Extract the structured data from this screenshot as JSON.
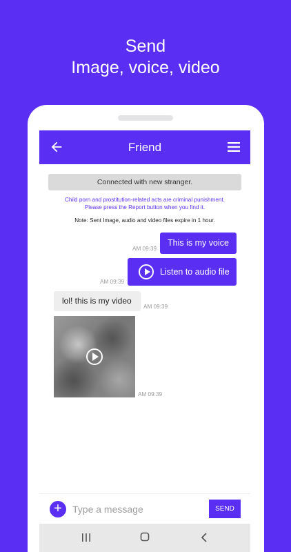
{
  "headline": {
    "line1": "Send",
    "line2": "Image, voice, video"
  },
  "appbar": {
    "title": "Friend",
    "back_icon": "arrow-back-icon",
    "menu_icon": "hamburger-menu-icon"
  },
  "chat": {
    "system_banner": "Connected with new stranger.",
    "warning_line1": "Child porn and prostitution-related acts are criminal punishment.",
    "warning_line2": "Please press the Report button when you find it.",
    "note": "Note: Sent Image, audio and video files expire in 1 hour.",
    "messages": [
      {
        "direction": "out",
        "text": "This is my voice",
        "time": "AM 09:39"
      },
      {
        "direction": "out",
        "text": "Listen to audio file",
        "time": "AM 09:39",
        "icon": "play-circle-icon"
      },
      {
        "direction": "in",
        "text": "lol! this is my video",
        "time": "AM 09:39"
      },
      {
        "direction": "in",
        "media": "video",
        "time": "AM 09:39",
        "icon": "play-circle-icon"
      }
    ]
  },
  "input": {
    "placeholder": "Type a message",
    "value": "",
    "send_label": "SEND",
    "add_icon": "plus-icon"
  },
  "navbar": {
    "icons": [
      "recent-apps-icon",
      "home-icon",
      "back-icon"
    ]
  },
  "colors": {
    "accent": "#5b2ef3",
    "incoming_bubble": "#eeeeee",
    "banner": "#dadada"
  }
}
